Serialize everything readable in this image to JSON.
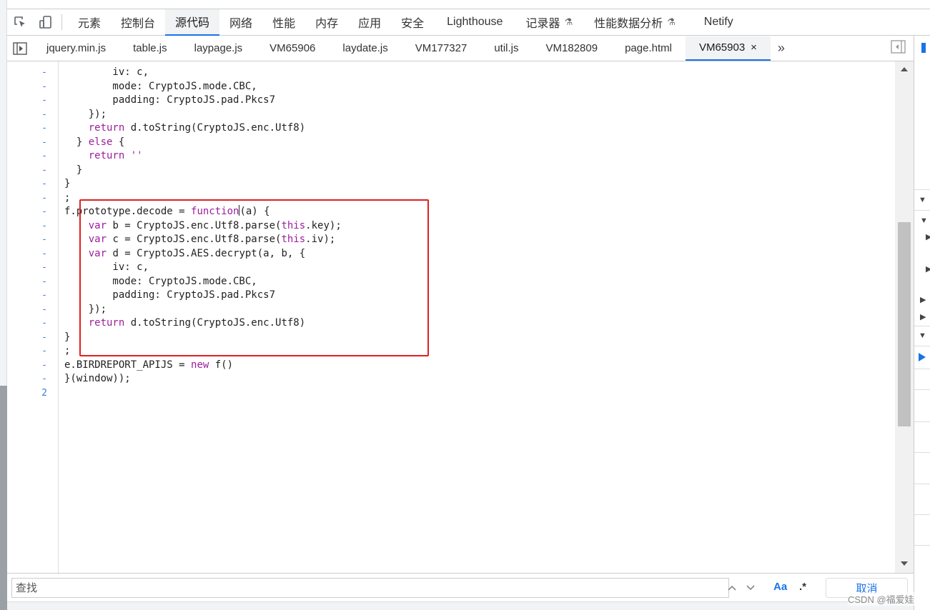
{
  "toolbar": {
    "tabs": [
      "元素",
      "控制台",
      "源代码",
      "网络",
      "性能",
      "内存",
      "应用",
      "安全",
      "Lighthouse",
      "记录器",
      "性能数据分析",
      "Netify"
    ],
    "active_tab": "源代码"
  },
  "file_tabs": {
    "items": [
      "jquery.min.js",
      "table.js",
      "laypage.js",
      "VM65906",
      "laydate.js",
      "VM177327",
      "util.js",
      "VM182809",
      "page.html",
      "VM65903"
    ],
    "active": "VM65903",
    "close_glyph": "×",
    "more_glyph": "»"
  },
  "editor": {
    "line_markers": [
      "-",
      "-",
      "-",
      "-",
      "-",
      "-",
      "-",
      "-",
      "-",
      "-",
      "-",
      "-",
      "-",
      "-",
      "-",
      "-",
      "-",
      "-",
      "-",
      "-",
      "-",
      "-",
      "-",
      "2"
    ],
    "code_lines": [
      [
        [
          "",
          "        iv: c,"
        ]
      ],
      [
        [
          "",
          "        mode: CryptoJS.mode.CBC,"
        ]
      ],
      [
        [
          "",
          "        padding: CryptoJS.pad.Pkcs7"
        ]
      ],
      [
        [
          "",
          "    });"
        ]
      ],
      [
        [
          "",
          "    "
        ],
        [
          "kw",
          "return"
        ],
        [
          "",
          " d.toString(CryptoJS.enc.Utf8)"
        ]
      ],
      [
        [
          "",
          "  } "
        ],
        [
          "kw",
          "else"
        ],
        [
          "",
          " {"
        ]
      ],
      [
        [
          "",
          "    "
        ],
        [
          "kw",
          "return"
        ],
        [
          "kw",
          " ''"
        ]
      ],
      [
        [
          "",
          "  }"
        ]
      ],
      [
        [
          "",
          "}"
        ]
      ],
      [
        [
          "",
          ";"
        ]
      ],
      [
        [
          "",
          "f.prototype.decode = "
        ],
        [
          "kw",
          "function"
        ],
        [
          "cursor",
          ""
        ],
        [
          "",
          "(a) {"
        ]
      ],
      [
        [
          "",
          "    "
        ],
        [
          "kw",
          "var"
        ],
        [
          "",
          " b = CryptoJS.enc.Utf8.parse("
        ],
        [
          "kw",
          "this"
        ],
        [
          "",
          ".key);"
        ]
      ],
      [
        [
          "",
          "    "
        ],
        [
          "kw",
          "var"
        ],
        [
          "",
          " c = CryptoJS.enc.Utf8.parse("
        ],
        [
          "kw",
          "this"
        ],
        [
          "",
          ".iv);"
        ]
      ],
      [
        [
          "",
          "    "
        ],
        [
          "kw",
          "var"
        ],
        [
          "",
          " d = CryptoJS.AES.decrypt(a, b, {"
        ]
      ],
      [
        [
          "",
          "        iv: c,"
        ]
      ],
      [
        [
          "",
          "        mode: CryptoJS.mode.CBC,"
        ]
      ],
      [
        [
          "",
          "        padding: CryptoJS.pad.Pkcs7"
        ]
      ],
      [
        [
          "",
          "    });"
        ]
      ],
      [
        [
          "",
          "    "
        ],
        [
          "kw",
          "return"
        ],
        [
          "",
          " d.toString(CryptoJS.enc.Utf8)"
        ]
      ],
      [
        [
          "",
          "}"
        ]
      ],
      [
        [
          "",
          ";"
        ]
      ],
      [
        [
          "",
          "e.BIRDREPORT_APIJS = "
        ],
        [
          "kw",
          "new"
        ],
        [
          "",
          " f()"
        ]
      ],
      [
        [
          "",
          "}(window));"
        ]
      ]
    ]
  },
  "search": {
    "placeholder": "查找",
    "case_label": "Aa",
    "regex_label": ".*",
    "cancel_label": "取消"
  },
  "watermark": "CSDN @福爱娃"
}
